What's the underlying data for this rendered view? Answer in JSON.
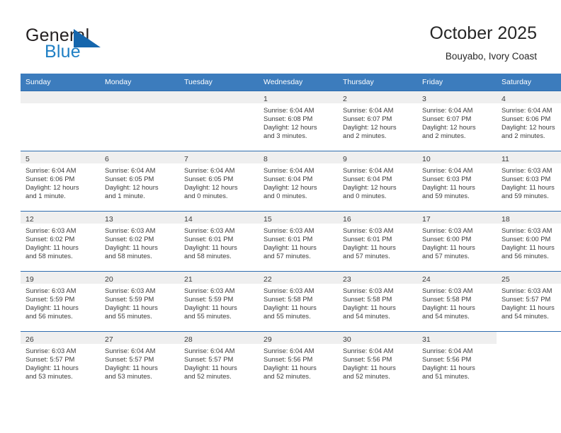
{
  "brand": {
    "name_part1": "General",
    "name_part2": "Blue",
    "accent_color": "#1f7fc4"
  },
  "header": {
    "title": "October 2025",
    "subtitle": "Bouyabo, Ivory Coast"
  },
  "theme": {
    "header_row_bg": "#3c7cbd",
    "daynum_band_bg": "#efefef",
    "grid_line": "#2f6daf",
    "text": "#3b3b3b"
  },
  "weekday_headers": [
    "Sunday",
    "Monday",
    "Tuesday",
    "Wednesday",
    "Thursday",
    "Friday",
    "Saturday"
  ],
  "weeks": [
    [
      {
        "day": "",
        "lines": []
      },
      {
        "day": "",
        "lines": []
      },
      {
        "day": "",
        "lines": []
      },
      {
        "day": "1",
        "lines": [
          "Sunrise: 6:04 AM",
          "Sunset: 6:08 PM",
          "Daylight: 12 hours",
          "and 3 minutes."
        ]
      },
      {
        "day": "2",
        "lines": [
          "Sunrise: 6:04 AM",
          "Sunset: 6:07 PM",
          "Daylight: 12 hours",
          "and 2 minutes."
        ]
      },
      {
        "day": "3",
        "lines": [
          "Sunrise: 6:04 AM",
          "Sunset: 6:07 PM",
          "Daylight: 12 hours",
          "and 2 minutes."
        ]
      },
      {
        "day": "4",
        "lines": [
          "Sunrise: 6:04 AM",
          "Sunset: 6:06 PM",
          "Daylight: 12 hours",
          "and 2 minutes."
        ]
      }
    ],
    [
      {
        "day": "5",
        "lines": [
          "Sunrise: 6:04 AM",
          "Sunset: 6:06 PM",
          "Daylight: 12 hours",
          "and 1 minute."
        ]
      },
      {
        "day": "6",
        "lines": [
          "Sunrise: 6:04 AM",
          "Sunset: 6:05 PM",
          "Daylight: 12 hours",
          "and 1 minute."
        ]
      },
      {
        "day": "7",
        "lines": [
          "Sunrise: 6:04 AM",
          "Sunset: 6:05 PM",
          "Daylight: 12 hours",
          "and 0 minutes."
        ]
      },
      {
        "day": "8",
        "lines": [
          "Sunrise: 6:04 AM",
          "Sunset: 6:04 PM",
          "Daylight: 12 hours",
          "and 0 minutes."
        ]
      },
      {
        "day": "9",
        "lines": [
          "Sunrise: 6:04 AM",
          "Sunset: 6:04 PM",
          "Daylight: 12 hours",
          "and 0 minutes."
        ]
      },
      {
        "day": "10",
        "lines": [
          "Sunrise: 6:04 AM",
          "Sunset: 6:03 PM",
          "Daylight: 11 hours",
          "and 59 minutes."
        ]
      },
      {
        "day": "11",
        "lines": [
          "Sunrise: 6:03 AM",
          "Sunset: 6:03 PM",
          "Daylight: 11 hours",
          "and 59 minutes."
        ]
      }
    ],
    [
      {
        "day": "12",
        "lines": [
          "Sunrise: 6:03 AM",
          "Sunset: 6:02 PM",
          "Daylight: 11 hours",
          "and 58 minutes."
        ]
      },
      {
        "day": "13",
        "lines": [
          "Sunrise: 6:03 AM",
          "Sunset: 6:02 PM",
          "Daylight: 11 hours",
          "and 58 minutes."
        ]
      },
      {
        "day": "14",
        "lines": [
          "Sunrise: 6:03 AM",
          "Sunset: 6:01 PM",
          "Daylight: 11 hours",
          "and 58 minutes."
        ]
      },
      {
        "day": "15",
        "lines": [
          "Sunrise: 6:03 AM",
          "Sunset: 6:01 PM",
          "Daylight: 11 hours",
          "and 57 minutes."
        ]
      },
      {
        "day": "16",
        "lines": [
          "Sunrise: 6:03 AM",
          "Sunset: 6:01 PM",
          "Daylight: 11 hours",
          "and 57 minutes."
        ]
      },
      {
        "day": "17",
        "lines": [
          "Sunrise: 6:03 AM",
          "Sunset: 6:00 PM",
          "Daylight: 11 hours",
          "and 57 minutes."
        ]
      },
      {
        "day": "18",
        "lines": [
          "Sunrise: 6:03 AM",
          "Sunset: 6:00 PM",
          "Daylight: 11 hours",
          "and 56 minutes."
        ]
      }
    ],
    [
      {
        "day": "19",
        "lines": [
          "Sunrise: 6:03 AM",
          "Sunset: 5:59 PM",
          "Daylight: 11 hours",
          "and 56 minutes."
        ]
      },
      {
        "day": "20",
        "lines": [
          "Sunrise: 6:03 AM",
          "Sunset: 5:59 PM",
          "Daylight: 11 hours",
          "and 55 minutes."
        ]
      },
      {
        "day": "21",
        "lines": [
          "Sunrise: 6:03 AM",
          "Sunset: 5:59 PM",
          "Daylight: 11 hours",
          "and 55 minutes."
        ]
      },
      {
        "day": "22",
        "lines": [
          "Sunrise: 6:03 AM",
          "Sunset: 5:58 PM",
          "Daylight: 11 hours",
          "and 55 minutes."
        ]
      },
      {
        "day": "23",
        "lines": [
          "Sunrise: 6:03 AM",
          "Sunset: 5:58 PM",
          "Daylight: 11 hours",
          "and 54 minutes."
        ]
      },
      {
        "day": "24",
        "lines": [
          "Sunrise: 6:03 AM",
          "Sunset: 5:58 PM",
          "Daylight: 11 hours",
          "and 54 minutes."
        ]
      },
      {
        "day": "25",
        "lines": [
          "Sunrise: 6:03 AM",
          "Sunset: 5:57 PM",
          "Daylight: 11 hours",
          "and 54 minutes."
        ]
      }
    ],
    [
      {
        "day": "26",
        "lines": [
          "Sunrise: 6:03 AM",
          "Sunset: 5:57 PM",
          "Daylight: 11 hours",
          "and 53 minutes."
        ]
      },
      {
        "day": "27",
        "lines": [
          "Sunrise: 6:04 AM",
          "Sunset: 5:57 PM",
          "Daylight: 11 hours",
          "and 53 minutes."
        ]
      },
      {
        "day": "28",
        "lines": [
          "Sunrise: 6:04 AM",
          "Sunset: 5:57 PM",
          "Daylight: 11 hours",
          "and 52 minutes."
        ]
      },
      {
        "day": "29",
        "lines": [
          "Sunrise: 6:04 AM",
          "Sunset: 5:56 PM",
          "Daylight: 11 hours",
          "and 52 minutes."
        ]
      },
      {
        "day": "30",
        "lines": [
          "Sunrise: 6:04 AM",
          "Sunset: 5:56 PM",
          "Daylight: 11 hours",
          "and 52 minutes."
        ]
      },
      {
        "day": "31",
        "lines": [
          "Sunrise: 6:04 AM",
          "Sunset: 5:56 PM",
          "Daylight: 11 hours",
          "and 51 minutes."
        ]
      },
      {
        "day": "",
        "lines": [],
        "no_band": true
      }
    ]
  ]
}
